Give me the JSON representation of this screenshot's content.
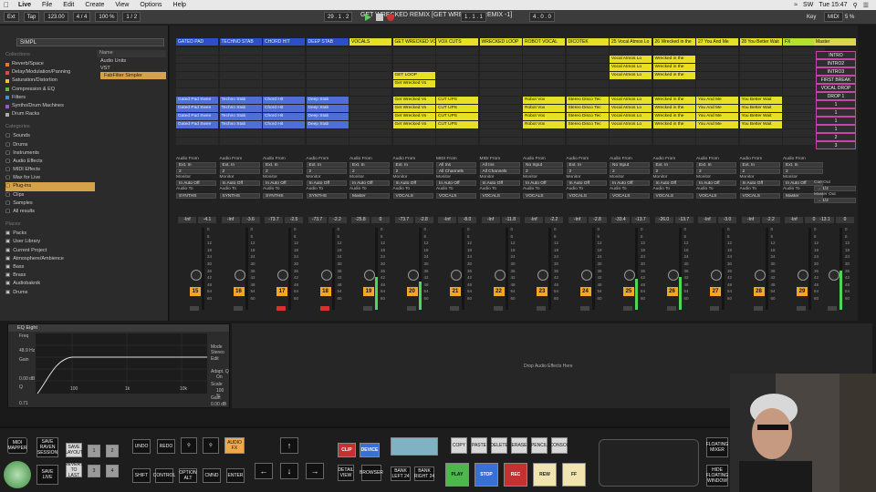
{
  "menubar": {
    "app": "Live",
    "items": [
      "File",
      "Edit",
      "Create",
      "View",
      "Options",
      "Help"
    ],
    "right_items": [
      "SW",
      "Tue 15:47"
    ]
  },
  "controlbar": {
    "ext": "Ext",
    "tap": "Tap",
    "tempo": "123.00",
    "signature": "4 / 4",
    "zoom": "100 %",
    "quantize": "1 / 2",
    "position": "29 . 1 . 2",
    "loop_start": "1 . 1 . 1",
    "loop_len": "4 . 0 . 0",
    "key": "Key",
    "midi": "MIDI",
    "cpu": "5 %",
    "set_title": "GET WRECKED REMIX  [GET WRECKED REMIX -1]"
  },
  "browser": {
    "search": "SIMPL",
    "collections_head": "Collections",
    "collections": [
      {
        "label": "Reverb/Space",
        "color": "#e8772b"
      },
      {
        "label": "Delay/Modulation/Panning",
        "color": "#e04848"
      },
      {
        "label": "Saturation/Distortion",
        "color": "#f5c32c"
      },
      {
        "label": "Compression & EQ",
        "color": "#6fb04a"
      },
      {
        "label": "Filters",
        "color": "#3d8de2"
      },
      {
        "label": "Synths/Drum Machines",
        "color": "#9b58c9"
      },
      {
        "label": "Drum Racks",
        "color": "#aaaaaa"
      }
    ],
    "categories_head": "Categories",
    "categories": [
      "Sounds",
      "Drums",
      "Instruments",
      "Audio Effects",
      "MIDI Effects",
      "Max for Live",
      "Plug-ins",
      "Clips",
      "Samples",
      "All results"
    ],
    "categories_selected": "Plug-ins",
    "places_head": "Places",
    "places": [
      "Packs",
      "User Library",
      "Current Project",
      "Atmosphere/Ambience",
      "Bass",
      "Brass",
      "Audiobaknik",
      "Drums"
    ],
    "name_head": "Name",
    "name_rows": [
      "Audio Units",
      "VST",
      "FabFilter Simpler"
    ]
  },
  "tracks": [
    {
      "name": "GATED PAD",
      "color": "blue"
    },
    {
      "name": "TECHNO STAB",
      "color": "blue"
    },
    {
      "name": "CHORD HIT",
      "color": "blue"
    },
    {
      "name": "DEEP STAB",
      "color": "blue"
    },
    {
      "name": "VOCALS",
      "color": "yellow"
    },
    {
      "name": "GET WRECKED VO",
      "color": "yellow"
    },
    {
      "name": "VOX CUTS",
      "color": "yellow"
    },
    {
      "name": "WRECKED LOOP",
      "color": "yellow"
    },
    {
      "name": "ROBOT VOCAL",
      "color": "yellow"
    },
    {
      "name": "DICOTEK",
      "color": "yellow"
    },
    {
      "name": "25 Vocal Atmos Lo",
      "color": "yellow"
    },
    {
      "name": "26 Wrecked in the",
      "color": "yellow"
    },
    {
      "name": "27 You And Me",
      "color": "yellow"
    },
    {
      "name": "28 You Better Wait",
      "color": "yellow"
    },
    {
      "name": "FX",
      "color": "lime"
    },
    {
      "name": "Master",
      "color": "master"
    }
  ],
  "clip_groups": [
    {
      "track": 0,
      "label": "Gated Pad Swee"
    },
    {
      "track": 1,
      "label": "Techno Stab"
    },
    {
      "track": 2,
      "label": "Chord Hit"
    },
    {
      "track": 3,
      "label": "Deep Stab"
    },
    {
      "track": 5,
      "label": "Get Wrecked Vo"
    },
    {
      "track": 6,
      "label": "CUT UPS"
    },
    {
      "track": 8,
      "label": "Robot Vox"
    },
    {
      "track": 9,
      "label": "Stereo Disco Tec"
    },
    {
      "track": 10,
      "label": "Vocal Atmos Lo"
    },
    {
      "track": 11,
      "label": "Wrecked in the"
    },
    {
      "track": 12,
      "label": "You And Me"
    },
    {
      "track": 13,
      "label": "You Better Wait"
    }
  ],
  "upper_clips": [
    {
      "track": 5,
      "row": 3,
      "label": "GET LOOP"
    },
    {
      "track": 5,
      "row": 4,
      "label": "Get Wrecked Vo"
    },
    {
      "track": 10,
      "row": 1,
      "label": "Vocal Atmos Lo"
    },
    {
      "track": 10,
      "row": 2,
      "label": "Vocal Atmos Lo"
    },
    {
      "track": 10,
      "row": 3,
      "label": "Vocal Atmos Lo"
    },
    {
      "track": 11,
      "row": 1,
      "label": "Wrecked in the"
    },
    {
      "track": 11,
      "row": 2,
      "label": "Wrecked in the"
    },
    {
      "track": 11,
      "row": 3,
      "label": "Wrecked in the"
    }
  ],
  "scenes": [
    "INTRO",
    "INTRO2",
    "INTRO3",
    "FIRST BREAK",
    "VOCAL DROP",
    "DROP 1",
    "1",
    "1",
    "1",
    "1",
    "2",
    "3"
  ],
  "io": {
    "audio_from": "Audio From",
    "midi_from": "MIDI From",
    "ext_in": "Ext. In",
    "all_ins": "All Ins",
    "all_channels": "All Channels",
    "no_input": "No Input",
    "monitor": "Monitor",
    "in": "In",
    "auto": "Auto",
    "off": "Off",
    "audio_to": "Audio To",
    "synths": "SYNTHS",
    "vocals": "VOCALS",
    "master": "Master",
    "cue_out": "Cue Out",
    "master_out": "Master Out",
    "cue_val": "→ 1/2",
    "master_out_val": "→ 1/2"
  },
  "mixer": {
    "channels": [
      {
        "num": "15",
        "vol": "-Inf",
        "peak": "-4.1",
        "meter": 0,
        "solo_red": false
      },
      {
        "num": "16",
        "vol": "-Inf",
        "peak": "-3.6",
        "meter": 0,
        "solo_red": false
      },
      {
        "num": "17",
        "vol": "-73.7",
        "peak": "-2.5",
        "meter": 0,
        "solo_red": true
      },
      {
        "num": "18",
        "vol": "-73.7",
        "peak": "-2.2",
        "meter": 0,
        "solo_red": true
      },
      {
        "num": "19",
        "vol": "-25.8",
        "peak": "0",
        "meter": 0.4,
        "solo_red": false
      },
      {
        "num": "20",
        "vol": "-73.7",
        "peak": "-2.8",
        "meter": 0.35,
        "solo_red": false
      },
      {
        "num": "21",
        "vol": "-Inf",
        "peak": "-8.0",
        "meter": 0,
        "solo_red": false
      },
      {
        "num": "22",
        "vol": "-Inf",
        "peak": "-11.8",
        "meter": 0,
        "solo_red": false
      },
      {
        "num": "23",
        "vol": "-Inf",
        "peak": "-2.2",
        "meter": 0,
        "solo_red": false
      },
      {
        "num": "24",
        "vol": "-Inf",
        "peak": "-2.8",
        "meter": 0,
        "solo_red": false
      },
      {
        "num": "25",
        "vol": "-33.4",
        "peak": "-13.7",
        "meter": 0.38,
        "solo_red": false
      },
      {
        "num": "26",
        "vol": "-26.0",
        "peak": "-13.7",
        "meter": 0.4,
        "solo_red": false
      },
      {
        "num": "27",
        "vol": "-Inf",
        "peak": "-3.0",
        "meter": 0,
        "solo_red": false
      },
      {
        "num": "28",
        "vol": "-Inf",
        "peak": "-2.2",
        "meter": 0,
        "solo_red": false
      },
      {
        "num": "29",
        "vol": "-Inf",
        "peak": "0",
        "meter": 0,
        "solo_red": false
      },
      {
        "num": "",
        "vol": "-13.1",
        "peak": "0",
        "meter": 0.48,
        "solo_red": false
      }
    ],
    "scale": [
      "0",
      "6",
      "12",
      "18",
      "24",
      "30",
      "36",
      "42",
      "48",
      "54",
      "60"
    ]
  },
  "device": {
    "title": "EQ Eight",
    "freq_label": "Freq",
    "freq_val": "48.9 Hz",
    "gain_label": "Gain",
    "gain_val": "0.00 dB",
    "q_label": "Q",
    "q_val": "0.71",
    "mode_label": "Mode",
    "mode_val": "Stereo",
    "edit": "Edit",
    "adapt_q": "Adapt. Q",
    "adapt_on": "On",
    "scale_label": "Scale",
    "scale_val": "100 %",
    "out_gain": "Gain",
    "out_gain_val": "0.00 dB",
    "axis": [
      "100",
      "1k",
      "10k"
    ],
    "db": [
      "12",
      "6",
      "0",
      "-6",
      "-12"
    ]
  },
  "drop_text": "Drop Audio Effects Here",
  "controller": {
    "labels": {
      "mode": "MIDI\nMAPPER",
      "save_session": "SAVE\nRAVEN\nSESSION",
      "save_layout": "SAVE\nLAYOUT",
      "revert": "REVERT\nTO\nLAST",
      "save_live": "SAVE\nLIVE",
      "n1": "1",
      "n2": "2",
      "n3": "3",
      "n4": "4",
      "undo": "UNDO",
      "redo": "REDO",
      "shift": "SHIFT",
      "control": "CONTROL",
      "option": "OPTION\nALT",
      "cmd": "CMND",
      "enter": "ENTER",
      "audio_fx": "AUDIO\nFX",
      "clip": "CLIP",
      "device": "DEVICE",
      "detail": "DETAIL\nVIEW",
      "browser": "BROWSER",
      "bank_left": "BANK\nLEFT 24",
      "bank_right": "BANK\nRIGHT 24",
      "play": "PLAY",
      "stop": "STOP",
      "rec": "REC",
      "rew": "REW",
      "ff": "FF",
      "copy": "COPY",
      "paste": "PASTE",
      "delete": "DELETE",
      "erase": "ERASE",
      "pencil": "PENCIL",
      "consol": "CONSOL",
      "floating_mixer": "FLOATING\nMIXER",
      "hide": "HIDE\nFLOATING\nWINDOW"
    }
  }
}
